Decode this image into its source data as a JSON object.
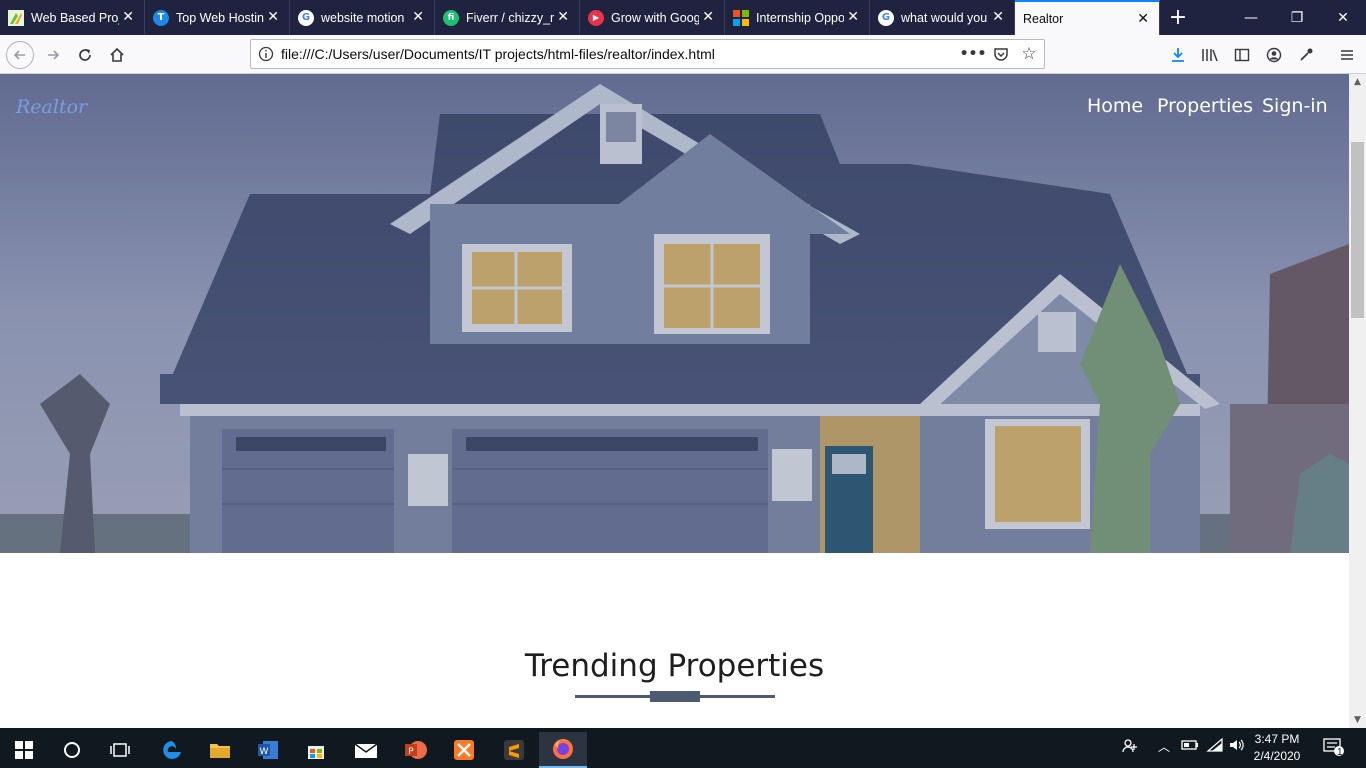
{
  "browser": {
    "tabs": [
      {
        "label": "Web Based Proj",
        "icon": "web-project-favicon",
        "color": "#6cbf3b"
      },
      {
        "label": "Top Web Hostin",
        "icon": "hosting-t-favicon",
        "color": "#1e88e5"
      },
      {
        "label": "website motion",
        "icon": "google-favicon",
        "color": "#ffffff"
      },
      {
        "label": "Fiverr / chizzy_r",
        "icon": "fiverr-favicon",
        "color": "#1dbf73"
      },
      {
        "label": "Grow with Goog",
        "icon": "grow-favicon",
        "color": "#e8334a"
      },
      {
        "label": "Internship Oppo",
        "icon": "microsoft-favicon",
        "color": "#f25022"
      },
      {
        "label": "what would you",
        "icon": "google-favicon",
        "color": "#ffffff"
      },
      {
        "label": "Realtor",
        "icon": "",
        "color": "#f9f9fb"
      }
    ],
    "url": "file:///C:/Users/user/Documents/IT projects/html-files/realtor/index.html"
  },
  "site": {
    "brand": "Realtor",
    "nav": [
      {
        "label": "Home"
      },
      {
        "label": "Properties"
      },
      {
        "label": "Sign-in"
      }
    ],
    "section_title": "Trending Properties"
  },
  "taskbar": {
    "time": "3:47 PM",
    "date": "2/4/2020",
    "notification_count": "1",
    "apps": [
      "start-icon",
      "cortana-icon",
      "task-view-icon",
      "edge-icon",
      "file-explorer-icon",
      "word-icon",
      "store-icon",
      "mail-icon",
      "powerpoint-icon",
      "xampp-icon",
      "sublime-icon",
      "firefox-icon"
    ]
  },
  "colors": {
    "tab_strip": "#202340",
    "active_tab_accent": "#0a84ff",
    "brand": "#7a9ce0",
    "accent_bar": "#4d5b72"
  }
}
